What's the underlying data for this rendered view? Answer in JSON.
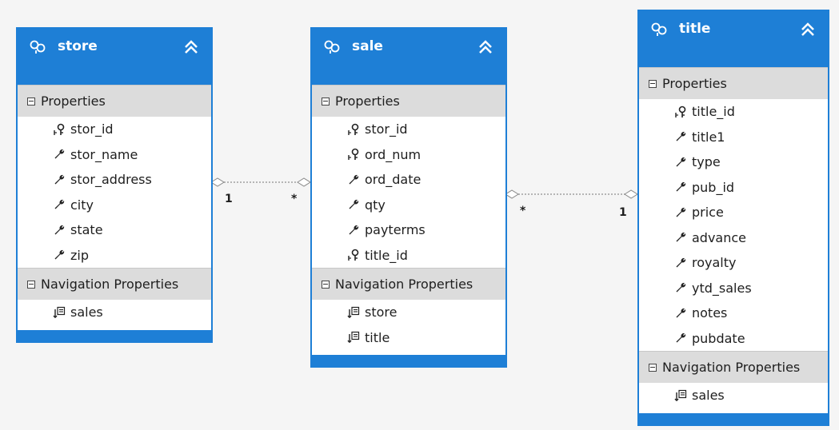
{
  "colors": {
    "accent": "#1e7fd6",
    "section_background": "#dcdcdc",
    "canvas_background": "#f5f5f5",
    "connector": "#a0a0a0"
  },
  "entities": [
    {
      "name": "store",
      "properties_label": "Properties",
      "properties": [
        {
          "name": "stor_id",
          "icon": "key-icon"
        },
        {
          "name": "stor_name",
          "icon": "wrench-icon"
        },
        {
          "name": "stor_address",
          "icon": "wrench-icon"
        },
        {
          "name": "city",
          "icon": "wrench-icon"
        },
        {
          "name": "state",
          "icon": "wrench-icon"
        },
        {
          "name": "zip",
          "icon": "wrench-icon"
        }
      ],
      "navigation_label": "Navigation Properties",
      "navigation": [
        {
          "name": "sales",
          "icon": "navigation-property-icon"
        }
      ]
    },
    {
      "name": "sale",
      "properties_label": "Properties",
      "properties": [
        {
          "name": "stor_id",
          "icon": "key-icon"
        },
        {
          "name": "ord_num",
          "icon": "key-icon"
        },
        {
          "name": "ord_date",
          "icon": "wrench-icon"
        },
        {
          "name": "qty",
          "icon": "wrench-icon"
        },
        {
          "name": "payterms",
          "icon": "wrench-icon"
        },
        {
          "name": "title_id",
          "icon": "key-icon"
        }
      ],
      "navigation_label": "Navigation Properties",
      "navigation": [
        {
          "name": "store",
          "icon": "navigation-property-icon"
        },
        {
          "name": "title",
          "icon": "navigation-property-icon"
        }
      ]
    },
    {
      "name": "title",
      "properties_label": "Properties",
      "properties": [
        {
          "name": "title_id",
          "icon": "key-icon"
        },
        {
          "name": "title1",
          "icon": "wrench-icon"
        },
        {
          "name": "type",
          "icon": "wrench-icon"
        },
        {
          "name": "pub_id",
          "icon": "wrench-icon"
        },
        {
          "name": "price",
          "icon": "wrench-icon"
        },
        {
          "name": "advance",
          "icon": "wrench-icon"
        },
        {
          "name": "royalty",
          "icon": "wrench-icon"
        },
        {
          "name": "ytd_sales",
          "icon": "wrench-icon"
        },
        {
          "name": "notes",
          "icon": "wrench-icon"
        },
        {
          "name": "pubdate",
          "icon": "wrench-icon"
        }
      ],
      "navigation_label": "Navigation Properties",
      "navigation": [
        {
          "name": "sales",
          "icon": "navigation-property-icon"
        }
      ]
    }
  ],
  "associations": [
    {
      "from_entity": "store",
      "to_entity": "sale",
      "from_multiplicity": "1",
      "to_multiplicity": "*"
    },
    {
      "from_entity": "sale",
      "to_entity": "title",
      "from_multiplicity": "*",
      "to_multiplicity": "1"
    }
  ]
}
